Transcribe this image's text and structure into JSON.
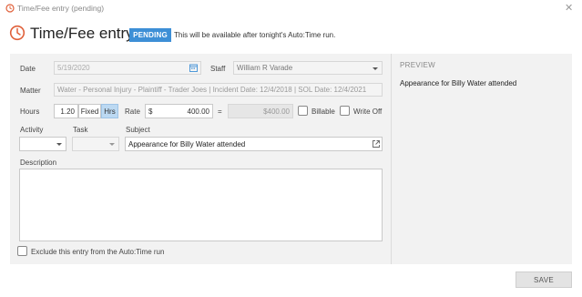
{
  "window": {
    "title": "Time/Fee entry (pending)"
  },
  "header": {
    "title": "Time/Fee entry",
    "badge": "PENDING",
    "note": "This will be available after tonight's Auto:Time run."
  },
  "form": {
    "date_label": "Date",
    "date_value": "5/19/2020",
    "staff_label": "Staff",
    "staff_value": "William R Varade",
    "matter_label": "Matter",
    "matter_value": "Water - Personal Injury - Plaintiff - Trader Joes | Incident Date: 12/4/2018 | SOL Date: 12/4/2021",
    "hours_label": "Hours",
    "hours_value": "1.20",
    "fixed_label": "Fixed",
    "hrs_label": "Hrs",
    "rate_label": "Rate",
    "currency_symbol": "$",
    "rate_value": "400.00",
    "equals": "=",
    "total_value": "$400.00",
    "billable_label": "Billable",
    "writeoff_label": "Write Off",
    "activity_label": "Activity",
    "activity_value": "",
    "task_label": "Task",
    "task_value": "",
    "subject_label": "Subject",
    "subject_value": "Appearance for Billy Water attended",
    "description_label": "Description",
    "description_value": "",
    "exclude_label": "Exclude this entry from the Auto:Time run"
  },
  "preview": {
    "heading": "PREVIEW",
    "text": "Appearance for Billy Water attended"
  },
  "actions": {
    "save_label": "SAVE"
  },
  "colors": {
    "accent": "#3d8fd6",
    "clock_icon": "#e0603a",
    "active_toggle": "#bcd9f2"
  }
}
